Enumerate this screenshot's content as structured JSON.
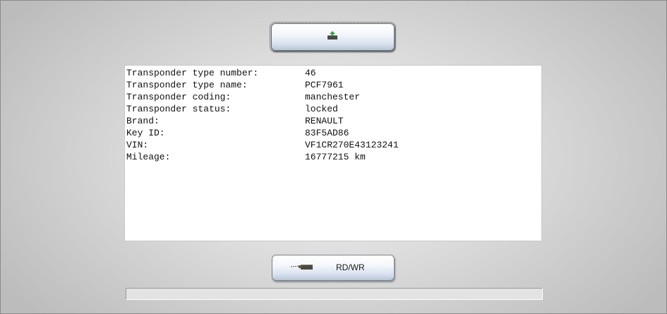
{
  "transponder_info": [
    {
      "label": "Transponder type number:",
      "value": "46"
    },
    {
      "label": "Transponder type name:",
      "value": "PCF7961"
    },
    {
      "label": "Transponder coding:",
      "value": "manchester"
    },
    {
      "label": "Transponder status:",
      "value": "locked"
    },
    {
      "label": "Brand:",
      "value": "RENAULT"
    },
    {
      "label": "Key ID:",
      "value": "83F5AD86"
    },
    {
      "label": "VIN:",
      "value": "VF1CR270E43123241"
    },
    {
      "label": "Mileage:",
      "value": "16777215 km"
    }
  ],
  "top_button": {
    "icon": "upload-icon"
  },
  "bottom_button": {
    "label": "RD/WR",
    "icon": "read-write-icon"
  },
  "progress": {
    "percent": 0
  }
}
